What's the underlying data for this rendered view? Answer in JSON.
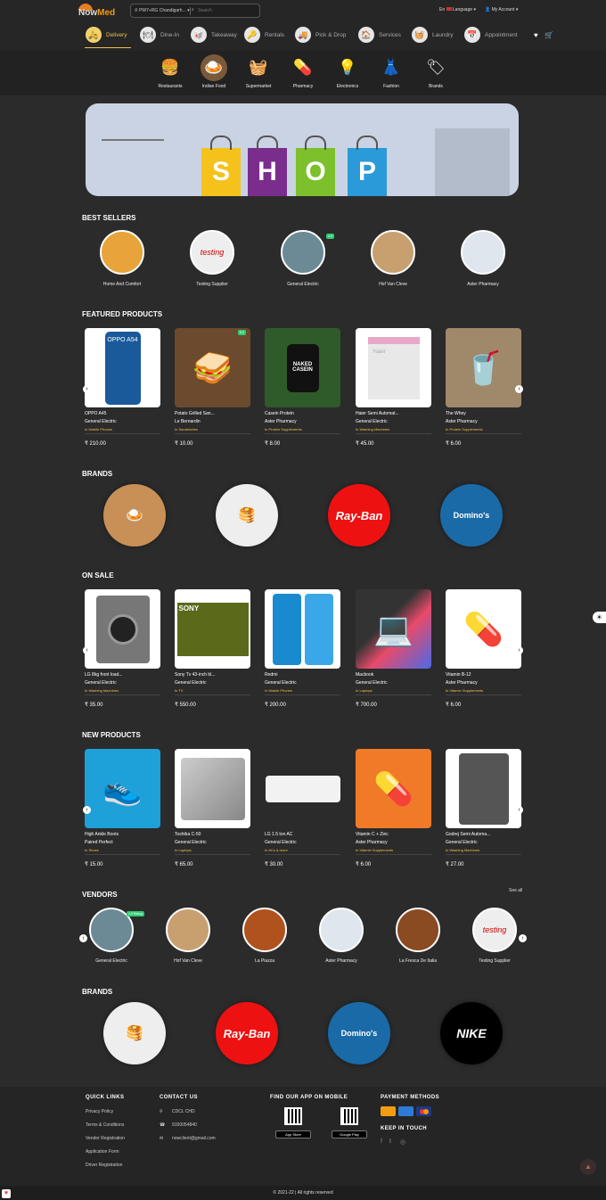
{
  "header": {
    "logo_now": "Now",
    "logo_med": "Med",
    "location": "PW7+RG Chandigarh...",
    "search_placeholder": "Search",
    "lang_short": "En",
    "language": "Language",
    "account": "My Account"
  },
  "services": [
    "Delivery",
    "Dine-In",
    "Takeaway",
    "Rentals",
    "Pick & Drop",
    "Services",
    "Laundry",
    "Appointment"
  ],
  "categories": [
    "Restaurants",
    "Indian Food",
    "Supermarket",
    "Pharmacy",
    "Electronics",
    "Fashion",
    "Brands"
  ],
  "banner": {
    "letters": [
      "S",
      "H",
      "O",
      "P"
    ]
  },
  "sections": {
    "best_sellers": "BEST SELLERS",
    "featured": "FEATURED PRODUCTS",
    "brands": "BRANDS",
    "on_sale": "ON SALE",
    "new_products": "NEW PRODUCTS",
    "vendors": "VENDORS",
    "brands2": "BRANDS",
    "see_all": "See all"
  },
  "best_sellers": [
    {
      "name": "Home And Comfort"
    },
    {
      "name": "Testing Supplier"
    },
    {
      "name": "General Electric",
      "rating": "4.0"
    },
    {
      "name": "Hof Van Cleve"
    },
    {
      "name": "Aster Pharmacy"
    }
  ],
  "featured": [
    {
      "name": "OPPO A45",
      "vendor": "General Electric",
      "category": "In Mobile Phones",
      "price": "₹ 210.00"
    },
    {
      "name": "Potato Grilled San...",
      "vendor": "Le Bernardin",
      "category": "In Sandwiches",
      "price": "₹ 10.00",
      "rating": "5.0"
    },
    {
      "name": "Casein Protein",
      "vendor": "Aster Pharmacy",
      "category": "In Protein Supplements",
      "price": "₹ 8.00"
    },
    {
      "name": "Haier Semi Automat...",
      "vendor": "General Electric",
      "category": "In Washing Machines",
      "price": "₹ 45.00"
    },
    {
      "name": "The Whey",
      "vendor": "Aster Pharmacy",
      "category": "In Protein Supplements",
      "price": "₹ 6.00"
    }
  ],
  "on_sale": [
    {
      "name": "LG 8kg front load...",
      "vendor": "General Electric",
      "category": "In Washing Machines",
      "price": "₹ 35.00"
    },
    {
      "name": "Sony Tv 43-inch bl...",
      "vendor": "General Electric",
      "category": "In TV",
      "price": "₹ 550.00"
    },
    {
      "name": "Redmi",
      "vendor": "General Electric",
      "category": "In Mobile Phones",
      "price": "₹ 200.00"
    },
    {
      "name": "Macbook",
      "vendor": "General Electric",
      "category": "In Laptops",
      "price": "₹ 700.00"
    },
    {
      "name": "Vitamin B-12",
      "vendor": "Aster Pharmacy",
      "category": "In Vitamin Supplements",
      "price": "₹ 6.00"
    }
  ],
  "new_products": [
    {
      "name": "High Ankle Boots",
      "vendor": "Paired Perfect",
      "category": "In Shoes",
      "price": "₹ 15.00"
    },
    {
      "name": "Toshiba C-50",
      "vendor": "General Electric",
      "category": "In Laptops",
      "price": "₹ 65.00"
    },
    {
      "name": "LG 1.5 ton AC",
      "vendor": "General Electric",
      "category": "In ACs & more",
      "price": "₹ 30.00"
    },
    {
      "name": "Vitamin C + Zinc",
      "vendor": "Aster Pharmacy",
      "category": "In Vitamin Supplements",
      "price": "₹ 6.00"
    },
    {
      "name": "Godrej Semi Automa...",
      "vendor": "General Electric",
      "category": "In Washing Machines",
      "price": "₹ 27.00"
    }
  ],
  "vendors": [
    {
      "name": "General Electric",
      "rating": "4.0 Rating"
    },
    {
      "name": "Hof Van Cleve"
    },
    {
      "name": "La Piazza"
    },
    {
      "name": "Aster Pharmacy"
    },
    {
      "name": "La Fresca De Italia"
    },
    {
      "name": "Testing Supplier"
    }
  ],
  "brand_labels": {
    "rayban": "Ray-Ban",
    "dominos": "Domino's",
    "nike": "NIKE",
    "sony": "SONY",
    "oppo": "OPPO A54",
    "testing": "testing",
    "naked": "NAKED CASEIN",
    "haier": "Haier"
  },
  "footer": {
    "quick_links_title": "QUICK LINKS",
    "quick_links": [
      "Privacy Policy",
      "Terms & Conditions",
      "Vendor Registration",
      "Application Form",
      "Driver Registration"
    ],
    "contact_title": "CONTACT US",
    "address": "CDCL CHD",
    "phone": "9150054840",
    "email": "nowclient@gmail.com",
    "app_title": "FIND OUR APP ON MOBILE",
    "app_store": "App Store",
    "google_play": "Google Play",
    "payment_title": "PAYMENT METHODS",
    "keep_title": "KEEP IN TOUCH",
    "copyright": "© 2021-22 | All rights reserved"
  }
}
